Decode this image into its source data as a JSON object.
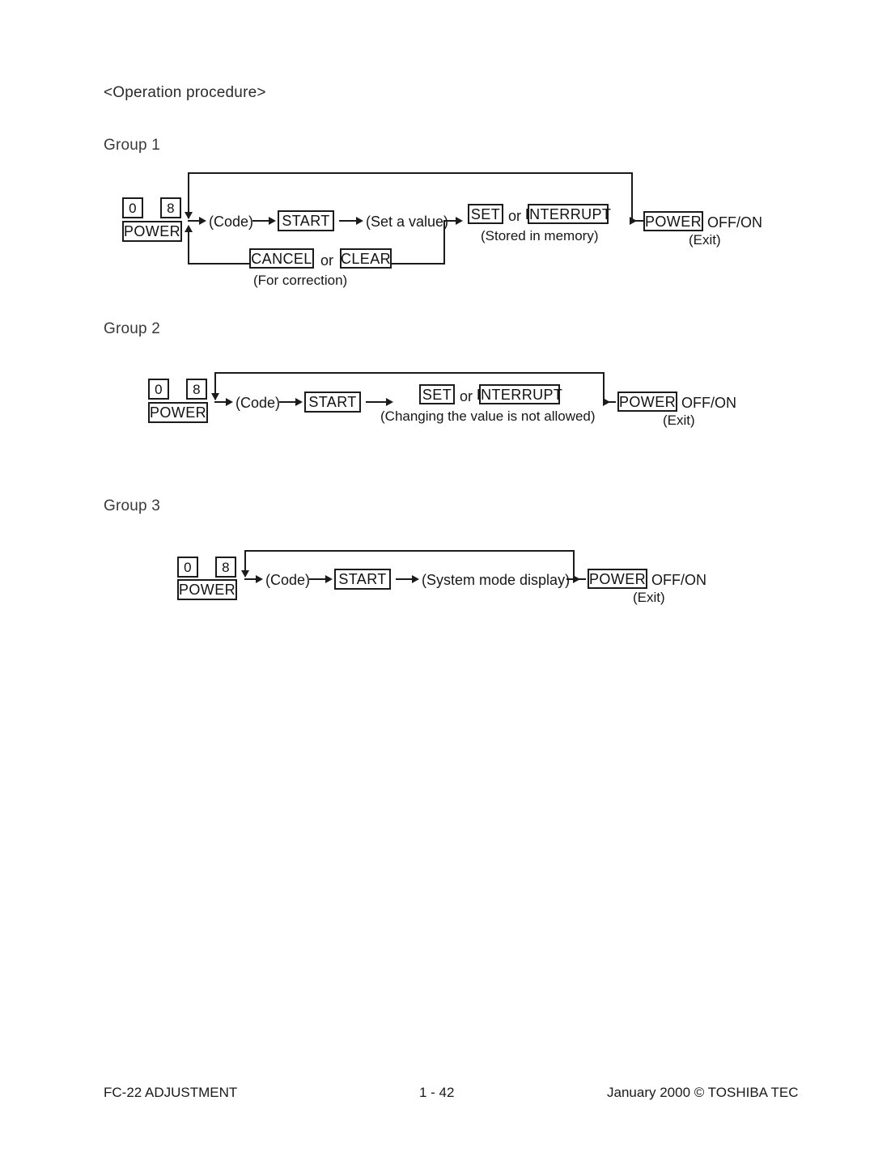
{
  "document": {
    "section_heading": "<Operation procedure>"
  },
  "groups": [
    {
      "label": "Group 1",
      "power_keys": {
        "key_0": "0",
        "key_8": "8",
        "power": "POWER"
      },
      "code": "(Code)",
      "start": "START",
      "action": "(Set a value)",
      "confirm_a": "SET",
      "or": "or",
      "confirm_b": "INTERRUPT",
      "confirm_note": "(Stored in memory)",
      "exit_key": "POWER",
      "exit_label": "OFF/ON",
      "exit_note": "(Exit)",
      "correction_a": "CANCEL",
      "correction_or": "or",
      "correction_b": "CLEAR",
      "correction_note": "(For correction)"
    },
    {
      "label": "Group 2",
      "power_keys": {
        "key_0": "0",
        "key_8": "8",
        "power": "POWER"
      },
      "code": "(Code)",
      "start": "START",
      "confirm_a": "SET",
      "or": "or",
      "confirm_b": "INTERRUPT",
      "confirm_note": "(Changing the value is not allowed)",
      "exit_key": "POWER",
      "exit_label": "OFF/ON",
      "exit_note": "(Exit)"
    },
    {
      "label": "Group 3",
      "power_keys": {
        "key_0": "0",
        "key_8": "8",
        "power": "POWER"
      },
      "code": "(Code)",
      "start": "START",
      "action": "(System mode display)",
      "exit_key": "POWER",
      "exit_label": "OFF/ON",
      "exit_note": "(Exit)"
    }
  ],
  "footer": {
    "left": "FC-22 ADJUSTMENT",
    "center": "1 - 42",
    "right": "January 2000  ©  TOSHIBA TEC"
  },
  "colors": {
    "ink": "#1b1b1b",
    "paper": "#ffffff"
  }
}
